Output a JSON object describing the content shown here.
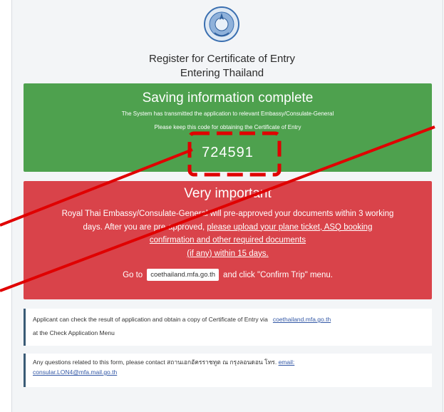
{
  "header": {
    "title_line1": "Register for Certificate of Entry",
    "title_line2": "Entering Thailand"
  },
  "success": {
    "heading": "Saving information complete",
    "line1": "The System has transmitted the application to relevant Embassy/Consulate-General",
    "line2": "Please keep this code for obtaining the Certificate of Entry",
    "code": "724591"
  },
  "important": {
    "heading": "Very important",
    "line1": "Royal Thai Embassy/Consulate-General will pre-approved your documents within 3 working",
    "line2_plain": "days. After you are pre-approved, ",
    "line2_link": "please upload your plane ticket, ASQ booking",
    "line3": "confirmation and other required documents",
    "line4": "(if any) within 15 days.",
    "goto_prefix": "Go to",
    "goto_site": "coethailand.mfa.go.th",
    "goto_suffix": "and click \"Confirm Trip\" menu."
  },
  "note1": {
    "text": "Applicant can check the result of application and obtain a copy of Certificate of Entry via",
    "link": "coethailand.mfa.go.th",
    "text2": "at the Check Application Menu"
  },
  "note2": {
    "text": "Any questions related to this form, please contact สถานเอกอัครราชทูต ณ กรุงลอนดอน โทร.",
    "link_label": "email:",
    "email": "consular.LON4@mfa.mail.go.th"
  },
  "colors": {
    "success_bg": "#4ea14e",
    "important_bg": "#d9434a",
    "annotation_red": "#e00000"
  },
  "icons": [
    "thai-government-seal-icon"
  ]
}
